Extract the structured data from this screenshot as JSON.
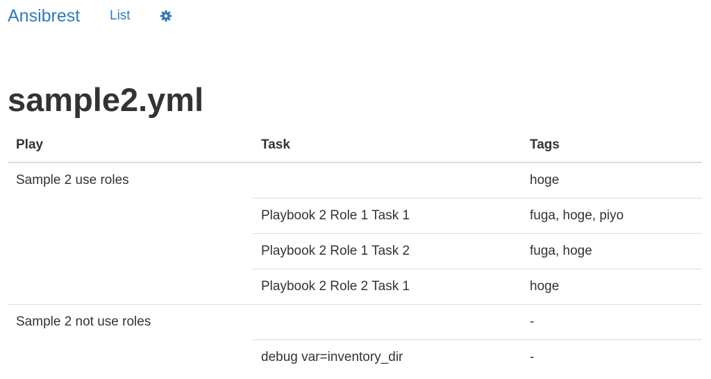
{
  "nav": {
    "brand": "Ansibrest",
    "list_label": "List",
    "settings_icon": "gear-icon",
    "accent_color": "#337ab7"
  },
  "page": {
    "title": "sample2.yml"
  },
  "table": {
    "headers": {
      "play": "Play",
      "task": "Task",
      "tags": "Tags"
    },
    "rows": [
      {
        "play": "Sample 2 use roles",
        "task": "",
        "tags": "hoge"
      },
      {
        "play": "",
        "task": "Playbook 2 Role 1 Task 1",
        "tags": "fuga, hoge, piyo"
      },
      {
        "play": "",
        "task": "Playbook 2 Role 1 Task 2",
        "tags": "fuga, hoge"
      },
      {
        "play": "",
        "task": "Playbook 2 Role 2 Task 1",
        "tags": "hoge"
      },
      {
        "play": "Sample 2 not use roles",
        "task": "",
        "tags": "-"
      },
      {
        "play": "",
        "task": "debug var=inventory_dir",
        "tags": "-"
      }
    ]
  }
}
